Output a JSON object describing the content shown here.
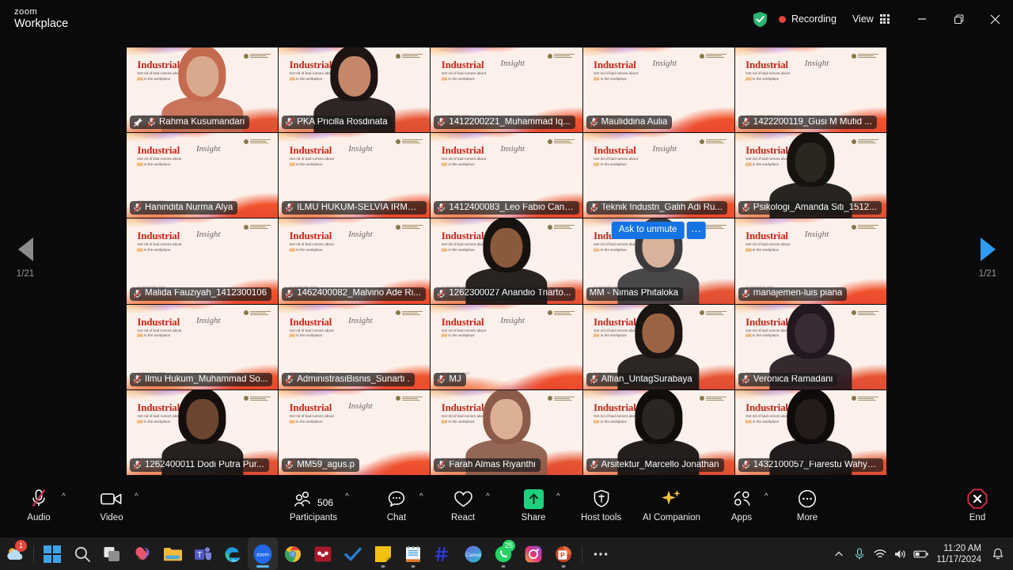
{
  "titlebar": {
    "brand_line1": "zoom",
    "brand_line2": "Workplace",
    "encryption_icon": "shield-check-icon",
    "recording_label": "Recording",
    "view_label": "View",
    "view_icon": "grid-view-icon",
    "minimize_icon": "minimize-icon",
    "restore_icon": "restore-icon",
    "close_icon": "close-icon"
  },
  "virtual_background": {
    "title": "Industrial",
    "script_word": "Insight",
    "line1": "Get rid of bad rumors about",
    "highlight": "you",
    "line1_tail": "in the workplace",
    "date": "17 November 2024"
  },
  "stage": {
    "pager_left": {
      "label": "1/21",
      "icon": "chevron-left-icon",
      "enabled": false
    },
    "pager_right": {
      "label": "1/21",
      "icon": "chevron-right-icon",
      "enabled": true
    },
    "hover_tile": {
      "ask_to_unmute": "Ask to unmute",
      "more_label": "···"
    },
    "participants": [
      {
        "name": "Rahma Kusumandari",
        "muted": true,
        "speaking": true,
        "pinned": true,
        "camera": true,
        "skin": "#d9a98d",
        "hair": "#c46a4f",
        "hairstyle": "hijab"
      },
      {
        "name": "PKA Pricilla Rosdinata",
        "muted": true,
        "camera": true,
        "skin": "#c4876a",
        "hair": "#1d1413",
        "hairstyle": "long"
      },
      {
        "name": "1412200221_Muhammad Iq...",
        "muted": true,
        "camera": false
      },
      {
        "name": "Mauliddina Aulia",
        "muted": true,
        "camera": false
      },
      {
        "name": "1422200119_Gusi M Mufid ...",
        "muted": true,
        "camera": false
      },
      {
        "name": "Hanindita Nurma Alya",
        "muted": true,
        "camera": false
      },
      {
        "name": "ILMU HUKUM-SELVIA IRMA ...",
        "muted": true,
        "camera": false
      },
      {
        "name": "1412400083_Leo Fabio Cana...",
        "muted": true,
        "camera": false
      },
      {
        "name": "Teknik Industri_Galih Adi Ru...",
        "muted": true,
        "camera": false
      },
      {
        "name": "Psikologi_Amanda Siti_1512...",
        "muted": true,
        "camera": true,
        "skin": "#2a2620",
        "hair": "#16130f",
        "hairstyle": "dark"
      },
      {
        "name": "Malida Fauziyah_1412300106",
        "muted": true,
        "camera": false
      },
      {
        "name": "1462400082_Malvino Ade Ri...",
        "muted": true,
        "camera": false
      },
      {
        "name": "1262300027 Anandio Triarto...",
        "muted": true,
        "camera": true,
        "skin": "#8a5a3c",
        "hair": "#171210",
        "hairstyle": "short"
      },
      {
        "name": "MM - Nimas Phitaloka",
        "muted": false,
        "camera": true,
        "hovered": true,
        "skin": "#d8b29a",
        "hair": "#3c3a3c",
        "hairstyle": "hijab"
      },
      {
        "name": "manajemen-luis piana",
        "muted": true,
        "camera": false
      },
      {
        "name": "Ilmu Hukum_Muhammad So...",
        "muted": true,
        "camera": false
      },
      {
        "name": "AdministrasiBisnis_Sunarti .",
        "muted": true,
        "camera": false
      },
      {
        "name": "MJ",
        "muted": true,
        "camera": false
      },
      {
        "name": "Alfian_UntagSurabaya",
        "muted": true,
        "camera": true,
        "skin": "#9a6444",
        "hair": "#1a1512",
        "hairstyle": "short"
      },
      {
        "name": "Veronica Ramadani",
        "muted": true,
        "camera": true,
        "skin": "#3a2c34",
        "hair": "#241820",
        "hairstyle": "dark"
      },
      {
        "name": "1262400011 Dodi Putra Pur...",
        "muted": true,
        "camera": true,
        "skin": "#6b4530",
        "hair": "#140f0d",
        "hairstyle": "short"
      },
      {
        "name": "MM59_agus.p",
        "muted": true,
        "camera": false
      },
      {
        "name": "Farah Almas Riyanthi",
        "muted": true,
        "camera": true,
        "skin": "#dcb094",
        "hair": "#8b5a48",
        "hairstyle": "hijab"
      },
      {
        "name": "Arsitektur_Marcello Jonathan",
        "muted": true,
        "camera": true,
        "skin": "#2c2622",
        "hair": "#110d0b",
        "hairstyle": "dark"
      },
      {
        "name": "1432100057_Fiarestu Wahyu...",
        "muted": true,
        "camera": true,
        "skin": "#241c1a",
        "hair": "#0f0b0a",
        "hairstyle": "dark"
      }
    ]
  },
  "toolbar": {
    "audio": {
      "label": "Audio",
      "icon": "microphone-muted-icon",
      "muted": true
    },
    "video": {
      "label": "Video",
      "icon": "camera-icon"
    },
    "participants": {
      "label": "Participants",
      "icon": "participants-icon",
      "count": "506"
    },
    "chat": {
      "label": "Chat",
      "icon": "chat-bubble-icon"
    },
    "react": {
      "label": "React",
      "icon": "heart-icon"
    },
    "share": {
      "label": "Share",
      "icon": "share-screen-icon"
    },
    "host_tools": {
      "label": "Host tools",
      "icon": "shield-icon"
    },
    "ai_companion": {
      "label": "AI Companion",
      "icon": "sparkle-icon"
    },
    "apps": {
      "label": "Apps",
      "icon": "apps-icon"
    },
    "more": {
      "label": "More",
      "icon": "more-ellipsis-icon"
    },
    "end": {
      "label": "End",
      "icon": "end-call-icon"
    }
  },
  "taskbar": {
    "items": [
      {
        "icon": "weather-widget-icon",
        "badge": "1"
      },
      {
        "icon": "windows-start-icon"
      },
      {
        "icon": "search-icon"
      },
      {
        "icon": "task-view-icon"
      },
      {
        "icon": "copilot-icon"
      },
      {
        "icon": "file-explorer-icon"
      },
      {
        "icon": "microsoft-teams-icon"
      },
      {
        "icon": "microsoft-edge-icon"
      },
      {
        "icon": "zoom-app-icon",
        "active": true
      },
      {
        "icon": "google-chrome-icon"
      },
      {
        "icon": "mendeley-icon"
      },
      {
        "icon": "microsoft-todo-icon"
      },
      {
        "icon": "sticky-notes-icon",
        "running": true
      },
      {
        "icon": "notepad-icon",
        "running": true
      },
      {
        "icon": "grammarly-icon"
      },
      {
        "icon": "canva-icon"
      },
      {
        "icon": "whatsapp-icon",
        "badge": "25",
        "running": true
      },
      {
        "icon": "instagram-icon"
      },
      {
        "icon": "powerpoint-icon",
        "running": true
      },
      {
        "icon": "taskbar-overflow-icon"
      }
    ],
    "tray": {
      "overflow_icon": "chevron-up-icon",
      "mic_icon": "microphone-icon",
      "wifi_icon": "wifi-icon",
      "volume_icon": "speaker-icon",
      "battery_icon": "battery-icon",
      "time": "11:20 AM",
      "date": "11/17/2024",
      "notification_icon": "bell-icon"
    }
  },
  "colors": {
    "accent_blue": "#1474e4",
    "speaking_green": "#33d16e",
    "recording_red": "#e8453c",
    "share_green": "#1ed17f",
    "end_red": "#e02e46"
  }
}
